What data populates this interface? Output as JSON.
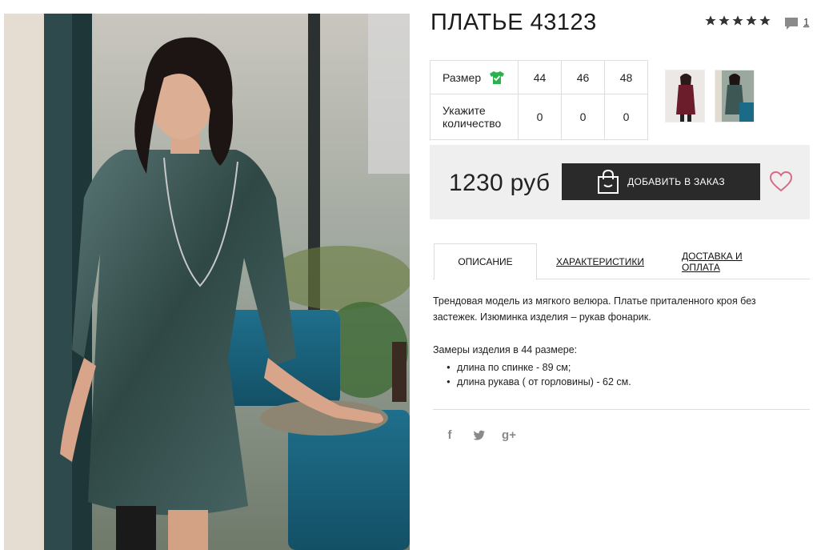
{
  "product": {
    "title": "ПЛАТЬЕ 43123",
    "rating_stars": 5,
    "reviews_count": "1"
  },
  "size_table": {
    "size_label": "Размер",
    "quantity_label_line1": "Укажите",
    "quantity_label_line2": "количество",
    "sizes": [
      "44",
      "46",
      "48"
    ],
    "quantities": [
      "0",
      "0",
      "0"
    ]
  },
  "thumbnails": [
    {
      "name": "burgundy-dress",
      "color": "#6b1d2c"
    },
    {
      "name": "teal-dress",
      "color": "#3d5754"
    }
  ],
  "purchase": {
    "price": "1230 руб",
    "add_button_label": "ДОБАВИТЬ В ЗАКАЗ"
  },
  "tabs": [
    {
      "label": "ОПИСАНИЕ",
      "active": true
    },
    {
      "label": "ХАРАКТЕРИСТИКИ",
      "active": false
    },
    {
      "label": "ДОСТАВКА И ОПЛАТА",
      "active": false
    }
  ],
  "description": {
    "text": "Трендовая модель из мягкого велюра. Платье приталенного кроя без застежек. Изюминка изделия – рукав фонарик.",
    "measurements_title": "Замеры изделия в 44 размере:",
    "measurements": [
      "длина по спинке - 89 см;",
      "длина рукава ( от горловины) - 62 см."
    ]
  },
  "social": {
    "facebook": "f",
    "twitter": "🐦",
    "googleplus": "g+"
  },
  "colors": {
    "button_bg": "#2a2a2a",
    "price_box_bg": "#efefef",
    "heart": "#d86a86",
    "shirt_icon": "#2bb24c"
  }
}
